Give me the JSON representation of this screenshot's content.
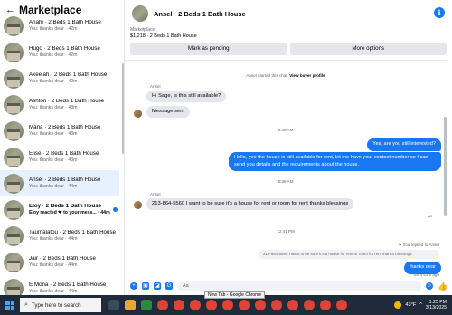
{
  "sidebar": {
    "title": "Marketplace",
    "items": [
      {
        "name": "Anahi · 2 Beds 1 Bath House",
        "preview": "You: thanks dear · 42m",
        "unread": false
      },
      {
        "name": "Hugo · 2 Beds 1 Bath House",
        "preview": "You: thanks dear · 42m",
        "unread": false
      },
      {
        "name": "Ākeelah · 2 Beds 1 Bath House",
        "preview": "You: thanks dear · 42m",
        "unread": false
      },
      {
        "name": "Ashton · 2 Beds 1 Bath House",
        "preview": "You: thanks dear · 43m",
        "unread": false
      },
      {
        "name": "Maria · 2 Beds 1 Bath House",
        "preview": "You: thanks dear · 43m",
        "unread": false
      },
      {
        "name": "Elise · 2 Beds 1 Bath House",
        "preview": "You: thanks dear · 43m",
        "unread": false
      },
      {
        "name": "Ansel · 2 Beds 1 Bath House",
        "preview": "You: thanks dear · 44m",
        "unread": false
      },
      {
        "name": "Eloy · 2 Beds 1 Bath House",
        "preview": "Eloy reacted ❤ to your mess... · 44m",
        "unread": true
      },
      {
        "name": "Taumalatou · 2 Beds 1 Bath House",
        "preview": "You: thanks dear · 44m",
        "unread": false
      },
      {
        "name": "Jair · 2 Beds 1 Bath House",
        "preview": "You: thanks dear · 44m",
        "unread": false
      },
      {
        "name": "E Mona · 2 Beds 1 Bath House",
        "preview": "You: thanks dear · 44m",
        "unread": false
      }
    ]
  },
  "conversation": {
    "title": "Ansel · 2 Beds 1 Bath House",
    "listing_label": "Marketplace",
    "listing_price": "$1,218 · 2 Beds 1 Bath House",
    "mark_pending": "Mark as pending",
    "more_options": "More options",
    "started_text": "Ansel started this chat.",
    "view_profile": "View buyer profile",
    "sender_name": "Ansel",
    "msg1": "Hi Sage, is this still available?",
    "msg2": "Message sent",
    "time1": "8:38 AM",
    "out1": "Yes, are you still interested?",
    "out2": "Hello, yes the house is still available for rent, let me have your contact number so I can send you details and the requirements about the house.",
    "time2": "5:38 AM",
    "sender_name2": "Ansel",
    "msg3": "213-864-5560 I want to be sure it's a house for rent or room for rent thanks blessings",
    "time3": "12:41 PM",
    "replied_label": "You replied to Ansel",
    "quoted": "213-864-5560 I want to be sure it's a house for rent or room for rent thanks blessings",
    "out3": "thanks dear",
    "sent_status": "Sent 44m ago",
    "composer_placeholder": "Aa"
  },
  "tooltip": "New Tab - Google Chrome",
  "taskbar": {
    "search_placeholder": "Type here to search",
    "temp": "43°F",
    "time": "1:25 PM",
    "date": "3/13/2025"
  },
  "colors": {
    "accent": "#1877f2",
    "taskbar": "#1f2b3a",
    "bubble_in": "#e4e6eb"
  }
}
